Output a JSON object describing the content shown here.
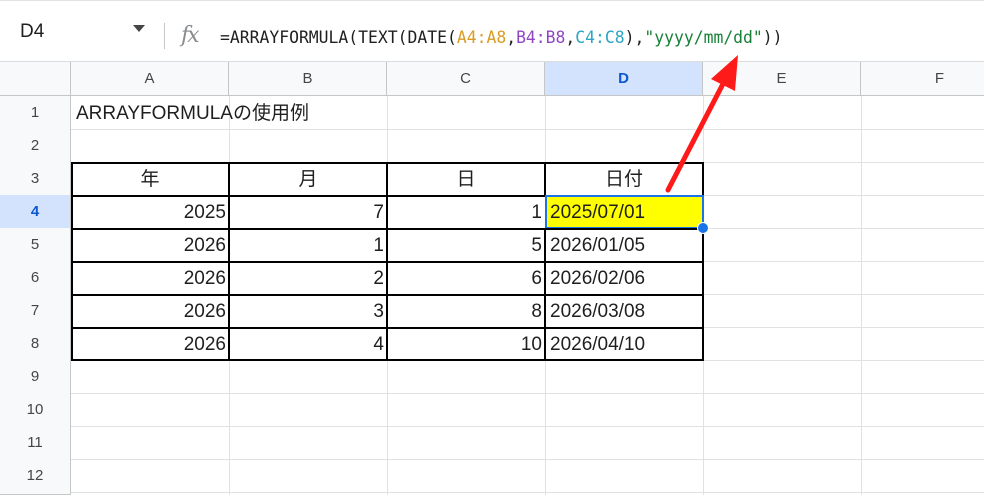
{
  "name_box": "D4",
  "formula": {
    "prefix": "=ARRAYFORMULA(TEXT(DATE(",
    "ref1": "A4:A8",
    "sep1": ",",
    "ref2": "B4:B8",
    "sep2": ",",
    "ref3": "C4:C8",
    "mid": "),",
    "str": "\"yyyy/mm/dd\"",
    "suffix": "))"
  },
  "columns": [
    "A",
    "B",
    "C",
    "D",
    "E",
    "F"
  ],
  "rows": [
    "1",
    "2",
    "3",
    "4",
    "5",
    "6",
    "7",
    "8",
    "9",
    "10",
    "11",
    "12"
  ],
  "title": "ARRAYFORMULAの使用例",
  "table": {
    "headers": [
      "年",
      "月",
      "日",
      "日付"
    ],
    "rows": [
      [
        "2025",
        "7",
        "1",
        "2025/07/01"
      ],
      [
        "2026",
        "1",
        "5",
        "2026/01/05"
      ],
      [
        "2026",
        "2",
        "6",
        "2026/02/06"
      ],
      [
        "2026",
        "3",
        "8",
        "2026/03/08"
      ],
      [
        "2026",
        "4",
        "10",
        "2026/04/10"
      ]
    ]
  },
  "colors": {
    "selection": "#1a73e8",
    "highlight": "#ffff00",
    "arrow": "#ff1a1a"
  }
}
